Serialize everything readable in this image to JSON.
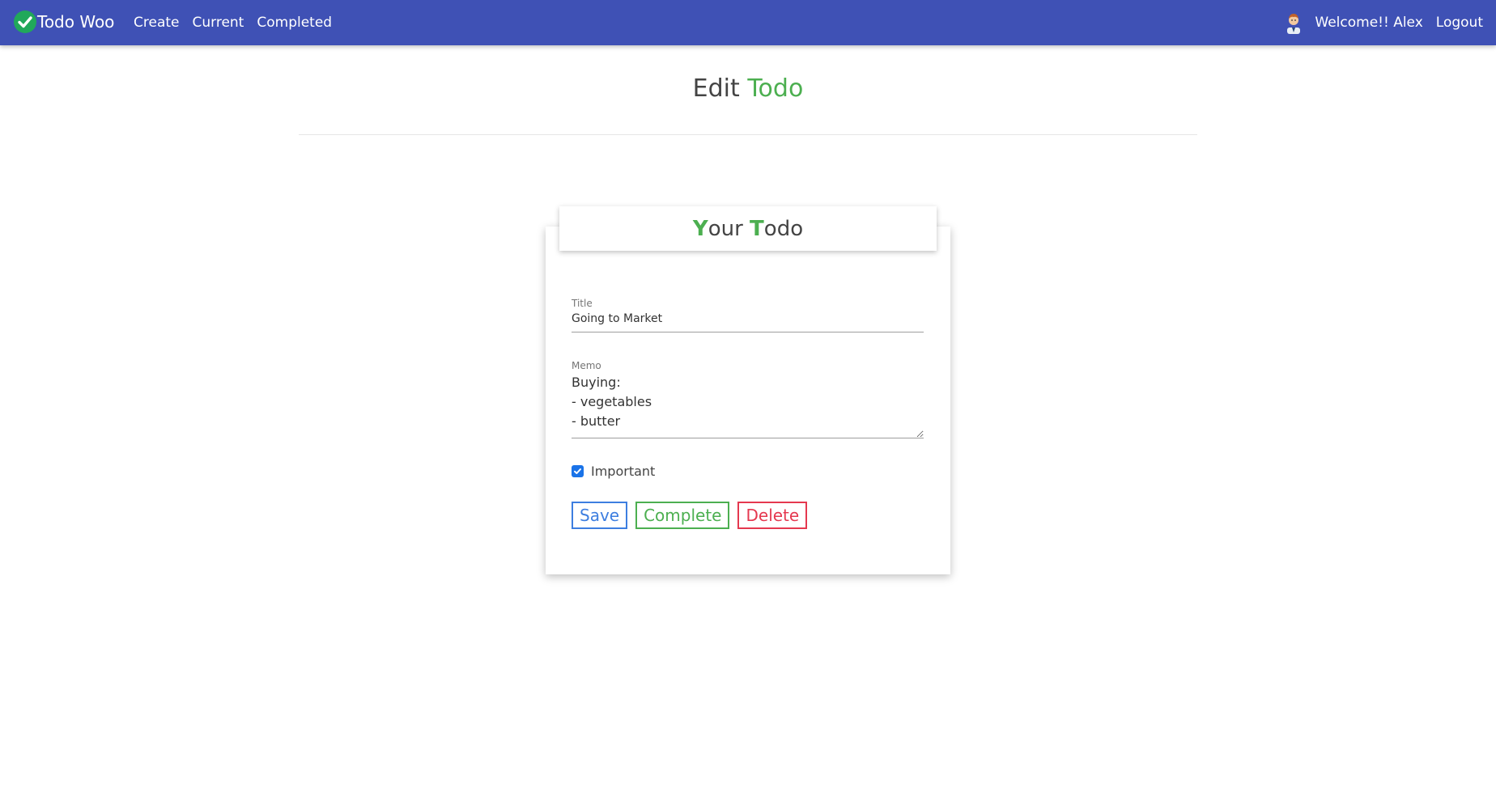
{
  "navbar": {
    "brand": "Todo Woo",
    "links": [
      "Create",
      "Current",
      "Completed"
    ],
    "welcome": "Welcome!! Alex",
    "logout": "Logout",
    "background": "#3f51b5",
    "logo_icon": "check-circle-icon",
    "avatar_icon": "user-avatar-icon"
  },
  "page": {
    "title_plain": "Edit",
    "title_accent": "Todo"
  },
  "card": {
    "header_y": "Y",
    "header_our": "our ",
    "header_t": "T",
    "header_odo": "odo",
    "title_label": "Title",
    "title_value": "Going to Market",
    "memo_label": "Memo",
    "memo_value": "Buying:\n- vegetables\n- butter",
    "important_label": "Important",
    "important_checked": true,
    "save_label": "Save",
    "complete_label": "Complete",
    "delete_label": "Delete"
  },
  "colors": {
    "accent_green": "#4caf50",
    "save_blue": "#3d7ee0",
    "delete_red": "#e5384f"
  }
}
